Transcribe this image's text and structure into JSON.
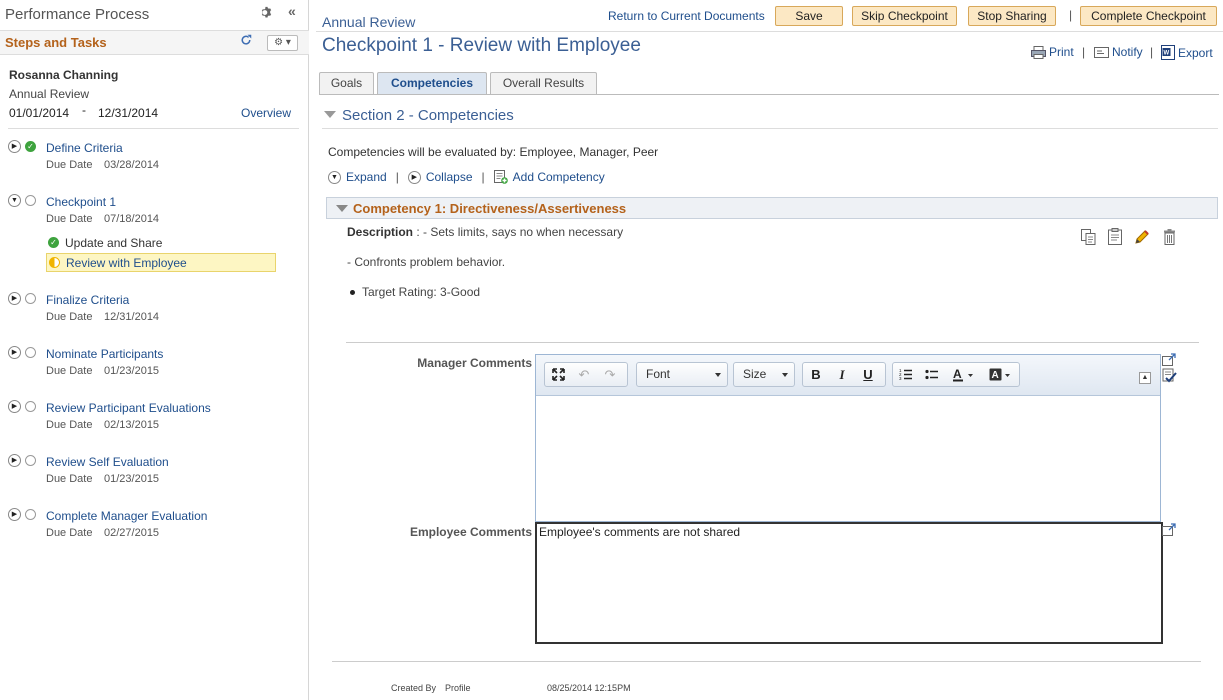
{
  "left": {
    "panel_title": "Performance Process",
    "collapse_glyph": "«",
    "steps_header": "Steps and Tasks",
    "employee_name": "Rosanna Channing",
    "document_type": "Annual Review",
    "period_from": "01/01/2014",
    "period_sep": "-",
    "period_to": "12/31/2014",
    "overview_link": "Overview",
    "due_label": "Due Date",
    "steps": [
      {
        "name": "Define Criteria",
        "due": "03/28/2014",
        "status": "complete"
      },
      {
        "name": "Checkpoint 1",
        "due": "07/18/2014",
        "status": "open",
        "subtasks": [
          {
            "name": "Update and Share",
            "status": "complete"
          },
          {
            "name": "Review with Employee",
            "status": "in-progress"
          }
        ]
      },
      {
        "name": "Finalize Criteria",
        "due": "12/31/2014",
        "status": "open"
      },
      {
        "name": "Nominate Participants",
        "due": "01/23/2015",
        "status": "open"
      },
      {
        "name": "Review Participant Evaluations",
        "due": "02/13/2015",
        "status": "open"
      },
      {
        "name": "Review Self Evaluation",
        "due": "01/23/2015",
        "status": "open"
      },
      {
        "name": "Complete Manager Evaluation",
        "due": "02/27/2015",
        "status": "open"
      }
    ]
  },
  "header": {
    "document_name": "Annual Review",
    "return_link": "Return to Current Documents",
    "buttons": {
      "save": "Save",
      "skip": "Skip Checkpoint",
      "stop": "Stop Sharing",
      "complete": "Complete Checkpoint"
    },
    "pipe": "|",
    "page_title": "Checkpoint 1 - Review with Employee",
    "actions": {
      "print": "Print",
      "notify": "Notify",
      "export": "Export"
    }
  },
  "tabs": [
    {
      "label": "Goals",
      "selected": false
    },
    {
      "label": "Competencies",
      "selected": true
    },
    {
      "label": "Overall Results",
      "selected": false
    }
  ],
  "section": {
    "title": "Section 2 - Competencies",
    "evaluated_by": "Competencies will be evaluated by: Employee, Manager, Peer",
    "expand": "Expand",
    "collapse": "Collapse",
    "add": "Add Competency"
  },
  "competency": {
    "title": "Competency 1: Directiveness/Assertiveness",
    "desc_label": "Description",
    "desc_text": " : - Sets limits, says no when necessary",
    "line2": "- Confronts problem behavior.",
    "line3": "Target Rating: 3-Good",
    "manager_label": "Manager Comments",
    "employee_label": "Employee Comments",
    "employee_text": "Employee's comments are not shared",
    "editor": {
      "font": "Font",
      "size": "Size",
      "bold": "B",
      "italic": "I",
      "underline": "U"
    }
  },
  "footer": {
    "created_by_label": "Created By",
    "created_by": "Profile",
    "created_on": "08/25/2014 12:15PM"
  },
  "colors": {
    "link": "#1f4e8c",
    "accent_orange": "#b4621b",
    "button_bg": "#fce8c4",
    "title_blue": "#3b5f94"
  }
}
